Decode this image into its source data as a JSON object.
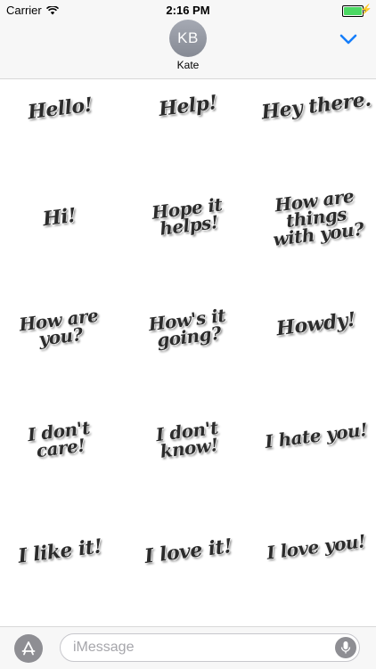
{
  "status_bar": {
    "carrier": "Carrier",
    "time": "2:16 PM",
    "battery_color": "#4cd964",
    "icons": [
      "wifi-icon",
      "battery-icon",
      "charging-bolt-icon"
    ]
  },
  "header": {
    "avatar_initials": "KB",
    "contact_name": "Kate",
    "accent_color": "#157efb",
    "collapse_icon": "chevron-down-icon"
  },
  "stickers": [
    {
      "text": "Hello!"
    },
    {
      "text": "Help!"
    },
    {
      "text": "Hey there."
    },
    {
      "text": "Hi!"
    },
    {
      "text": "Hope it helps!"
    },
    {
      "text": "How are things with you?"
    },
    {
      "text": "How are you?"
    },
    {
      "text": "How's it going?"
    },
    {
      "text": "Howdy!"
    },
    {
      "text": "I don't care!"
    },
    {
      "text": "I don't know!"
    },
    {
      "text": "I hate you!"
    },
    {
      "text": "I like it!"
    },
    {
      "text": "I love it!"
    },
    {
      "text": "I love you!"
    }
  ],
  "input_bar": {
    "placeholder": "iMessage",
    "value": "",
    "app_icon": "app-store-icon",
    "mic_icon": "microphone-icon"
  }
}
